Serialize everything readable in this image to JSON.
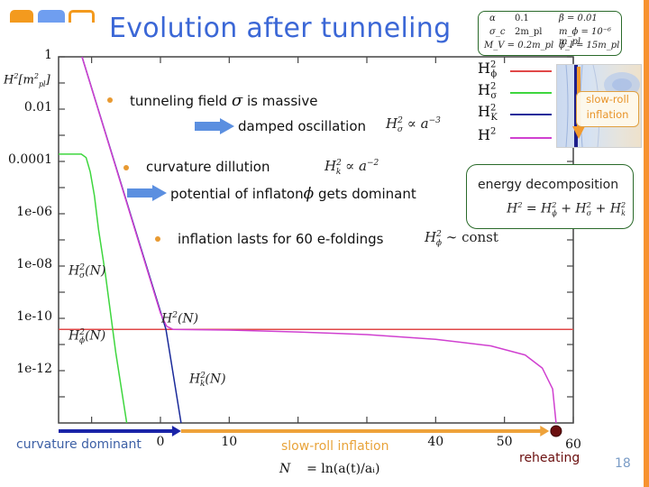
{
  "slide": {
    "title": "Evolution after tunneling",
    "page_number": "18",
    "logo_colors": [
      "#f39a1e",
      "#6f9ef0",
      "#f39a1e"
    ],
    "title_color": "#3b67d6",
    "accent_bar_color": "#f7922f"
  },
  "bullets": [
    {
      "text": "tunneling field",
      "symbol": "σ",
      "text_after": "is massive"
    },
    {
      "text": "curvature dillution"
    },
    {
      "text": "inflation lasts for 60 e-foldings"
    }
  ],
  "consequences": [
    {
      "text": "damped oscillation",
      "formula": "H²σ ∝ a⁻³"
    },
    {
      "text": "potential of inflaton",
      "symbol": "ϕ",
      "text_after": "gets dominant"
    }
  ],
  "formulas": {
    "curvature": {
      "lhs": "H",
      "sup": "2",
      "sub": "k",
      "rhs": "∝ a",
      "rhs_sup": "−2"
    },
    "sigma": {
      "lhs": "H",
      "sup": "2",
      "sub": "σ",
      "rhs": "∝ a",
      "rhs_sup": "−3"
    },
    "phi_const": {
      "lhs": "H",
      "sup": "2",
      "sub": "ϕ",
      "rhs": "∼ const"
    }
  },
  "parameters": {
    "rows": [
      {
        "c1": "α",
        "c2": "0.1",
        "c3": "β = 0.01"
      },
      {
        "c1": "σ_c",
        "c2": "2m_pl",
        "c3": "m_ϕ = 10⁻⁶ m_pl"
      },
      {
        "c1": "M_V = 0.2m_pl",
        "c2": "",
        "c3": "ϕ_I = 15m_pl"
      }
    ]
  },
  "legend": [
    {
      "label": "H",
      "sup": "2",
      "sub": "ϕ",
      "color": "#e04848"
    },
    {
      "label": "H",
      "sup": "2",
      "sub": "σ",
      "color": "#3ed63e"
    },
    {
      "label": "H",
      "sup": "2",
      "sub": "K",
      "color": "#1a2a9a"
    },
    {
      "label": "H",
      "sup": "2",
      "sub": "",
      "color": "#d040d0"
    }
  ],
  "inset": {
    "label_line1": "slow-roll",
    "label_line2": "inflation"
  },
  "energy_box": {
    "title": "energy decomposition",
    "equation": "H² = H²ϕ + H²σ + H²k"
  },
  "annotations": {
    "curvature_dominant": "curvature dominant",
    "slow_roll_inflation": "slow-roll inflation",
    "reheating": "reheating",
    "x_axis_label_N": "N",
    "x_axis_label_eq": "= ln(a(t)/aᵢ)",
    "curvature_color": "#1a24a8",
    "slow_roll_color": "#eea23a",
    "reheating_color": "#6b0f0f"
  },
  "curve_labels": {
    "sigma": {
      "base": "H",
      "sup": "2",
      "sub": "σ",
      "arg": "(N)"
    },
    "phi": {
      "base": "H",
      "sup": "2",
      "sub": "ϕ",
      "arg": "(N)"
    },
    "total": {
      "base": "H",
      "sup": "2",
      "sub": "",
      "arg": "(N)"
    },
    "kinetic": {
      "base": "H",
      "sup": "2",
      "sub": "k",
      "arg": "(N)"
    }
  },
  "chart_data": {
    "type": "line",
    "title": "Evolution after tunneling",
    "xlabel": "N = ln(a(t)/a_i)",
    "ylabel": "H²[m_pl²]",
    "yscale": "log",
    "xlim": [
      -14.8,
      60
    ],
    "ylim_log10": [
      -14,
      0
    ],
    "x_ticks": [
      -10,
      0,
      10,
      20,
      30,
      40,
      50,
      60
    ],
    "x_tick_labels": [
      "",
      "0",
      "10",
      "",
      "",
      "40",
      "50",
      "60"
    ],
    "y_ticks_log10": [
      0,
      -2,
      -4,
      -6,
      -8,
      -10,
      -12
    ],
    "y_tick_labels": [
      "1",
      "0.01",
      "0.0001",
      "1e-06",
      "1e-08",
      "1e-10",
      "1e-12"
    ],
    "grid": false,
    "legend_position": "top-right",
    "series": [
      {
        "name": "H²ϕ",
        "color": "#e04848",
        "points_log10": [
          [
            -14.8,
            -10.42
          ],
          [
            60,
            -10.42
          ]
        ]
      },
      {
        "name": "H²σ",
        "color": "#3ed63e",
        "points_log10": [
          [
            -14.8,
            -3.72
          ],
          [
            -11.5,
            -3.72
          ],
          [
            -10.8,
            -3.85
          ],
          [
            -10.2,
            -4.4
          ],
          [
            -9.6,
            -5.3
          ],
          [
            -9.0,
            -6.6
          ],
          [
            -8.0,
            -8.3
          ],
          [
            -6.5,
            -11.3
          ],
          [
            -4.9,
            -14
          ]
        ]
      },
      {
        "name": "H²K",
        "color": "#1a2a9a",
        "points_log10": [
          [
            -11.4,
            0
          ],
          [
            0.8,
            -10.42
          ],
          [
            3.0,
            -14
          ]
        ]
      },
      {
        "name": "H²",
        "color": "#d040d0",
        "points_log10": [
          [
            -11.4,
            0
          ],
          [
            0.0,
            -9.8
          ],
          [
            0.9,
            -10.3
          ],
          [
            1.8,
            -10.42
          ],
          [
            10,
            -10.45
          ],
          [
            20,
            -10.52
          ],
          [
            30,
            -10.62
          ],
          [
            40,
            -10.8
          ],
          [
            48,
            -11.05
          ],
          [
            53,
            -11.4
          ],
          [
            55.5,
            -11.9
          ],
          [
            57,
            -12.7
          ],
          [
            57.5,
            -14
          ]
        ]
      }
    ],
    "phase_arrows": [
      {
        "name": "curvature dominant",
        "from": -14.8,
        "to": 3.0,
        "color": "#1a24a8"
      },
      {
        "name": "slow-roll inflation",
        "from": 3.0,
        "to": 56.5,
        "color": "#eea23a"
      }
    ],
    "reheating_point": {
      "x": 57.5,
      "color": "#6b0f0f"
    }
  }
}
